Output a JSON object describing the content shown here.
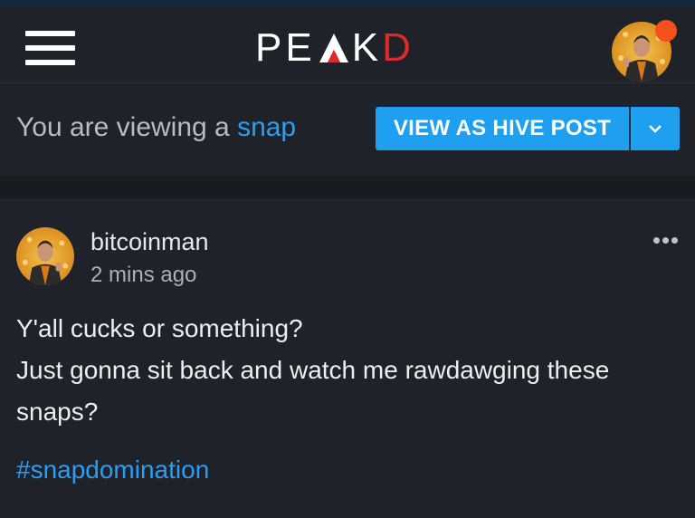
{
  "header": {
    "logo_text_left": "PE",
    "logo_text_right": "K",
    "logo_text_red": "D",
    "logo_alt": "PEAKD"
  },
  "viewbar": {
    "prefix": "You are viewing a ",
    "link": "snap",
    "button_label": "VIEW AS HIVE POST"
  },
  "post": {
    "author": "bitcoinman",
    "time": "2 mins ago",
    "lines": [
      "Y'all cucks or something?",
      "Just gonna sit back and watch me rawdawging these snaps?"
    ],
    "hashtag": "#snapdomination"
  },
  "icons": {
    "menu": "hamburger-icon",
    "dropdown": "chevron-down-icon",
    "more": "more-dots-icon",
    "notification": "notification-dot"
  },
  "colors": {
    "accent": "#1f9ff0",
    "link": "#2a9df4",
    "brand_red": "#e0272d",
    "notification": "#f4511e"
  }
}
